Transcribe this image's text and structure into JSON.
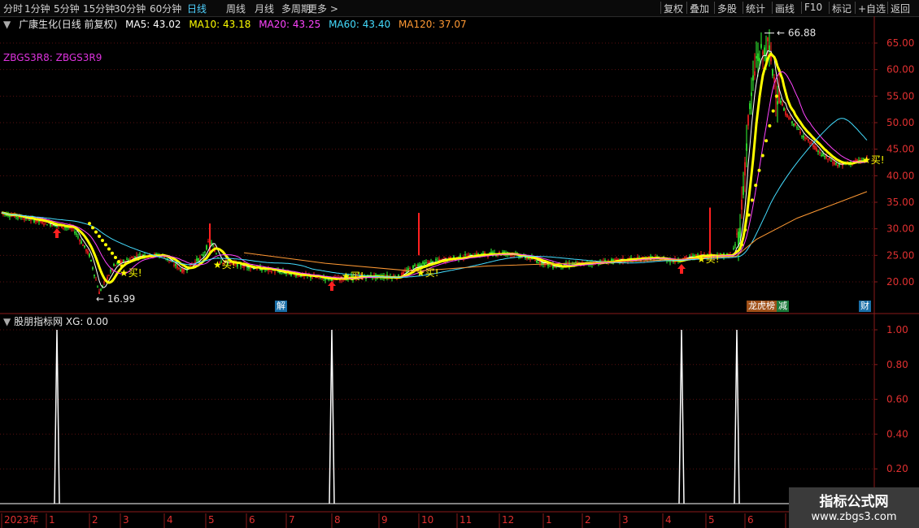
{
  "toolbar": {
    "periods": [
      "分时",
      "1分钟",
      "5分钟",
      "15分钟",
      "30分钟",
      "60分钟",
      "日线",
      "周线",
      "月线",
      "多周期",
      "更多 >"
    ],
    "active_period": "日线",
    "actions": [
      "复权",
      "叠加",
      "多股",
      "统计",
      "画线",
      "F10",
      "标记",
      "+自选",
      "返回"
    ]
  },
  "price_panel": {
    "title": "广康生化(日线 前复权)",
    "ma5": "MA5: 43.02",
    "ma10": "MA10: 43.18",
    "ma20": "MA20: 43.25",
    "ma60": "MA60: 43.40",
    "ma120": "MA120: 37.07",
    "indicator_label": "ZBGS3R8: ZBGS3R9",
    "high_label": "66.88",
    "low_label": "16.99",
    "buy_label": "买!",
    "y_ticks": [
      "65.00",
      "60.00",
      "55.00",
      "50.00",
      "45.00",
      "40.00",
      "35.00",
      "30.00",
      "25.00",
      "20.00"
    ],
    "badges": [
      "解",
      "龙虎榜",
      "减",
      "财"
    ],
    "colors": {
      "ma5": "#ffffff",
      "ma10": "#ffff00",
      "ma20": "#ff44ff",
      "ma60": "#44ddff",
      "ma120": "#ff9933",
      "up": "#ff2020",
      "down": "#33ff33"
    }
  },
  "indicator_panel": {
    "title": "股朋指标网 XG: 0.00",
    "y_ticks": [
      "1.00",
      "0.80",
      "0.60",
      "0.40",
      "0.20"
    ],
    "signals": [
      "2023-01-30",
      "2023-07-31",
      "2024-04-22",
      "2024-05-27"
    ]
  },
  "time_axis": {
    "labels": [
      "2023年",
      "1",
      "2",
      "3",
      "4",
      "5",
      "6",
      "7",
      "8",
      "9",
      "10",
      "11",
      "12",
      "1",
      "2",
      "3",
      "4",
      "5",
      "6",
      "7"
    ]
  },
  "watermark": {
    "line1": "指标公式网",
    "line2": "www.zbgs3.com"
  }
}
